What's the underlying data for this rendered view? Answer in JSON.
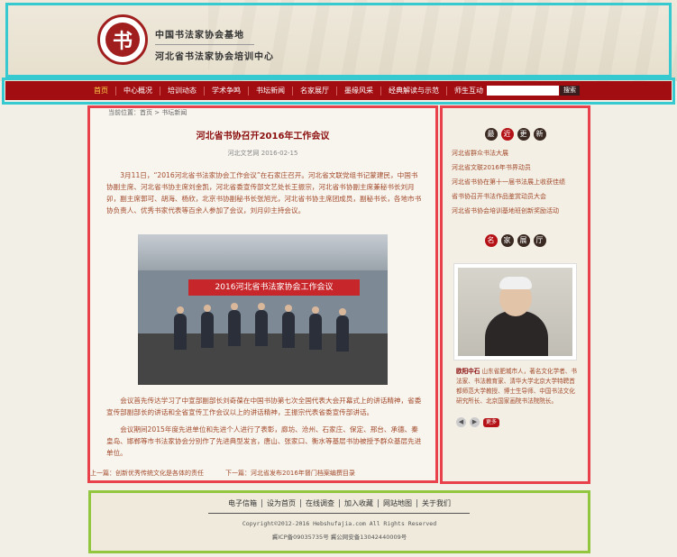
{
  "header": {
    "logo_char": "书",
    "line1": "中国书法家协会基地",
    "line2": "河北省书法家协会培训中心"
  },
  "nav": {
    "items": [
      "首页",
      "中心概况",
      "培训动态",
      "学术争鸣",
      "书坛新闻",
      "名家展厅",
      "墨缘风采",
      "经典解读与示范",
      "师生互动"
    ],
    "search_placeholder": "",
    "search_button": "搜索"
  },
  "article": {
    "breadcrumb": "当前位置：首页 > 书坛新闻",
    "title": "河北省书协召开2016年工作会议",
    "meta": "河北文艺网   2016-02-15",
    "p1": "3月11日，“2016河北省书法家协会工作会议”在石家庄召开。河北省文联党组书记蒙建民，中国书协副主席、河北省书协主席刘金凯，河北省委宣传部文艺处长王振宗，河北省书协副主席兼秘书长刘月卯，副主席郭可、胡海、杨欣，北京书协副秘书长张旭光，河北省书协主席团成员，副秘书长，各地市书协负责人、优秀书家代表等百余人参加了会议，刘月卯主持会议。",
    "photo_banner": "2016河北省书法家协会工作会议",
    "p2": "会议首先传达学习了中宣部副部长刘奇葆在中国书协第七次全国代表大会开幕式上的讲话精神，省委宣传部副部长的讲话和全省宣传工作会议以上的讲话精神，王振宗代表省委宣传部讲话。",
    "p3": "会议期间2015年度先进单位和先进个人进行了表彰，廊坊、沧州、石家庄、保定、邢台、承德、秦皇岛、邯郸等市书法家协会分别作了先进典型发言，唐山、张家口、衡水等基层书协被授予群众基层先进单位。",
    "prev": "上一篇：创新优秀传统文化是各体的责任",
    "next": "下一篇：河北省发布2016年督门档案编撰目录"
  },
  "sidebar": {
    "latest_head": [
      "最",
      "近",
      "更",
      "新"
    ],
    "latest": [
      "河北省群众书法大展",
      "河北省文联2016年书界动员",
      "河北省书协在第十一届书法展上收获佳绩",
      "省书协召开书法作品鉴赏动员大会",
      "河北省书协会培训基地班创新奖励活动"
    ],
    "famous_head": [
      "名",
      "家",
      "展",
      "厅"
    ],
    "famous_name": "欧阳中石",
    "famous_bio": "山东省肥城市人，著名文化学者、书法家、书法教育家、清华大学北京大学特聘首都师范大学教授、博士生导师、中国书法文化研究所长、北京国家画院书法院院长。",
    "more": "更多"
  },
  "footer": {
    "links": [
      "电子信箱",
      "设为首页",
      "在线调查",
      "加入收藏",
      "网站地图",
      "关于我们"
    ],
    "copyright": "Copyright©2012-2016 Hebshufajia.com All Rights Reserved",
    "icp": "冀ICP备09035735号 冀公网安备13042440009号"
  }
}
